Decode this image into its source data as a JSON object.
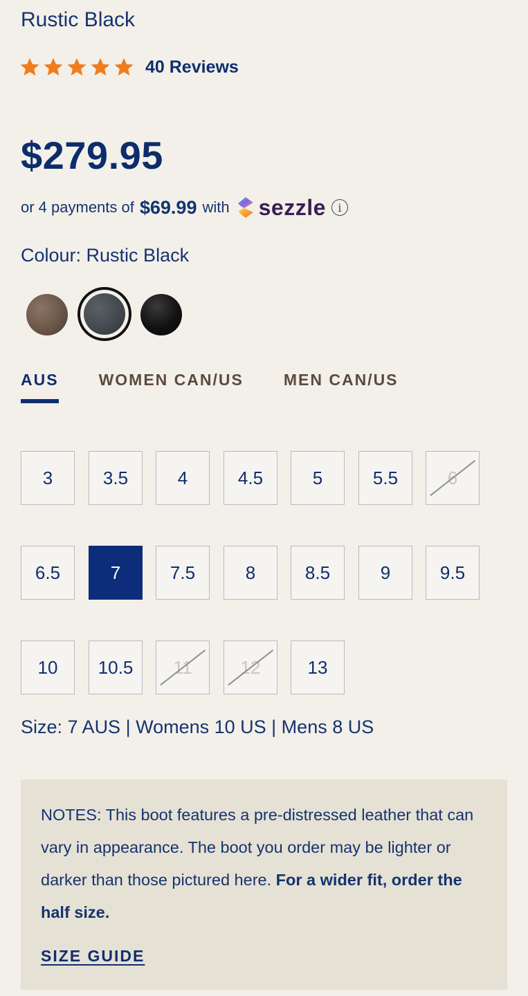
{
  "product": {
    "subtitle": "Rustic Black",
    "rating": 5,
    "reviews_label": "40 Reviews",
    "price": "$279.95",
    "star_color": "#f07c1c"
  },
  "payments": {
    "prefix": "or 4 payments of",
    "amount": "$69.99",
    "middle": "with",
    "brand": "sezzle",
    "info_icon": "info-icon"
  },
  "colour": {
    "label": "Colour: Rustic Black",
    "swatches": [
      {
        "name": "brown",
        "color": "#6b5748",
        "selected": false
      },
      {
        "name": "rustic-black",
        "color": "#41474c",
        "selected": true
      },
      {
        "name": "black",
        "color": "#121212",
        "selected": false
      }
    ]
  },
  "size_tabs": [
    {
      "label": "AUS",
      "active": true
    },
    {
      "label": "WOMEN CAN/US",
      "active": false
    },
    {
      "label": "MEN CAN/US",
      "active": false
    }
  ],
  "sizes": [
    {
      "label": "3",
      "state": "available"
    },
    {
      "label": "3.5",
      "state": "available"
    },
    {
      "label": "4",
      "state": "available"
    },
    {
      "label": "4.5",
      "state": "available"
    },
    {
      "label": "5",
      "state": "available"
    },
    {
      "label": "5.5",
      "state": "available"
    },
    {
      "label": "6",
      "state": "unavailable"
    },
    {
      "label": "6.5",
      "state": "available"
    },
    {
      "label": "7",
      "state": "selected"
    },
    {
      "label": "7.5",
      "state": "available"
    },
    {
      "label": "8",
      "state": "available"
    },
    {
      "label": "8.5",
      "state": "available"
    },
    {
      "label": "9",
      "state": "available"
    },
    {
      "label": "9.5",
      "state": "available"
    },
    {
      "label": "10",
      "state": "available"
    },
    {
      "label": "10.5",
      "state": "available"
    },
    {
      "label": "11",
      "state": "unavailable"
    },
    {
      "label": "12",
      "state": "unavailable"
    },
    {
      "label": "13",
      "state": "available"
    }
  ],
  "size_summary": "Size: 7 AUS | Womens 10 US | Mens 8 US",
  "notes": {
    "text": "NOTES: This boot features a pre-distressed leather that can vary in appearance. The boot you order may be lighter or darker than those pictured here. ",
    "bold": "For a wider fit, order the half size.",
    "size_guide": "SIZE GUIDE"
  }
}
